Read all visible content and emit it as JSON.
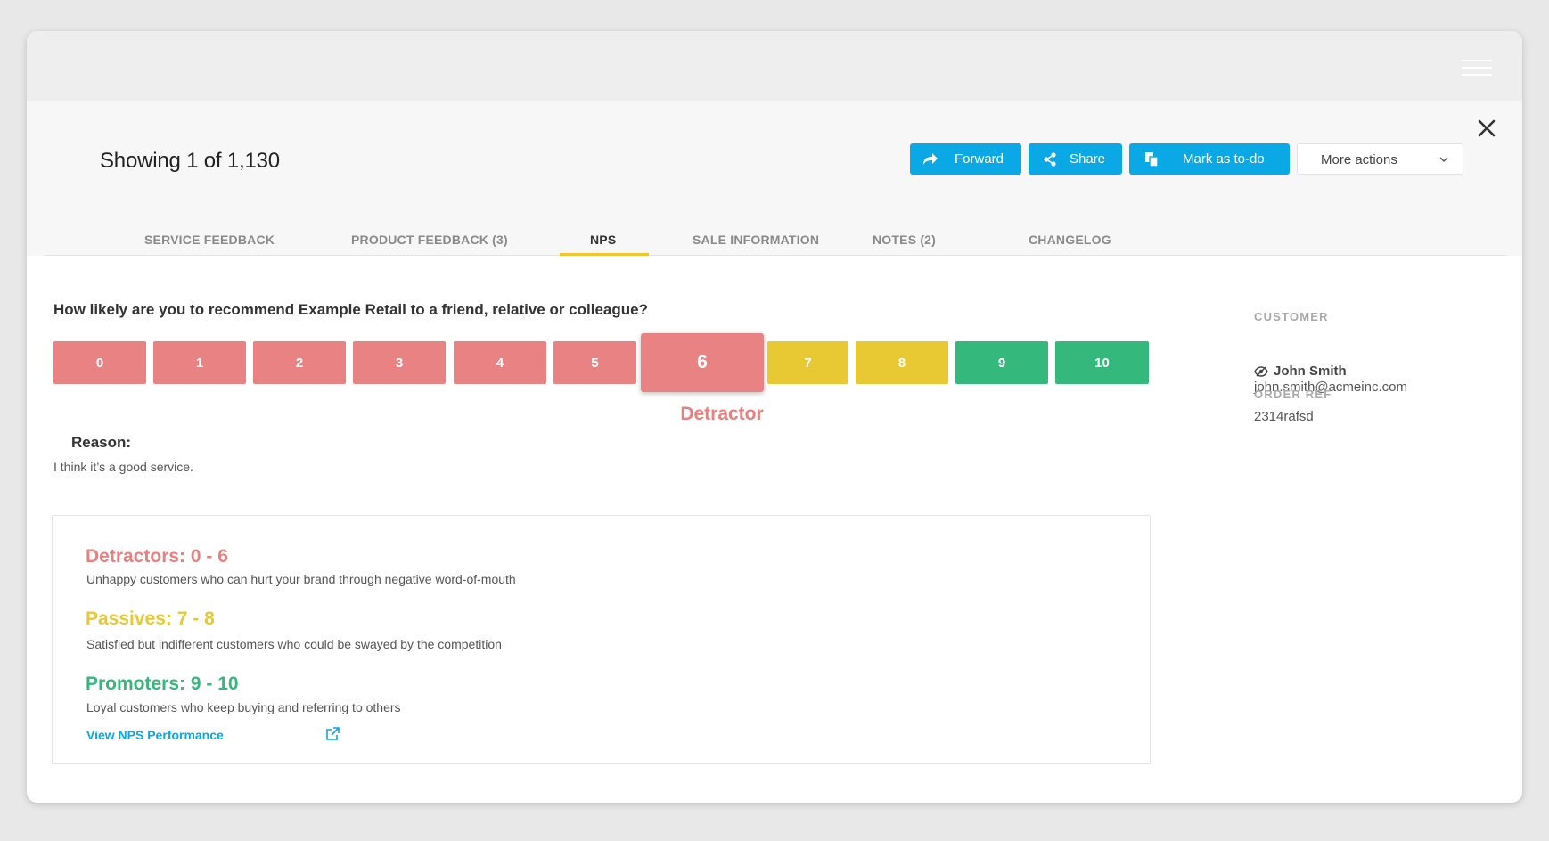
{
  "header": {
    "title": "Showing 1 of 1,130",
    "actions": {
      "forward_label": "Forward",
      "share_label": "Share",
      "todo_label": "Mark as to-do",
      "more_label": "More actions"
    }
  },
  "tabs": [
    {
      "label": "SERVICE FEEDBACK"
    },
    {
      "label": "PRODUCT FEEDBACK (3)"
    },
    {
      "label": "NPS"
    },
    {
      "label": "SALE INFORMATION"
    },
    {
      "label": "NOTES (2)"
    },
    {
      "label": "CHANGELOG"
    }
  ],
  "active_tab": "NPS",
  "nps": {
    "question": "How likely are you to recommend Example Retail to a friend, relative or colleague?",
    "scores": [
      "0",
      "1",
      "2",
      "3",
      "4",
      "5",
      "6",
      "7",
      "8",
      "9",
      "10"
    ],
    "selected_score": 6,
    "verdict": "Detractor",
    "reason_label": "Reason:",
    "reason_text": "I think it’s a good service."
  },
  "legend": {
    "detractors": {
      "title": "Detractors: 0 - 6",
      "desc": "Unhappy customers who can hurt your brand through negative word-of-mouth"
    },
    "passives": {
      "title": "Passives: 7 - 8",
      "desc": "Satisfied but indifferent customers who could be swayed by the competition"
    },
    "promoters": {
      "title": "Promoters: 9 - 10",
      "desc": "Loyal customers who keep buying and referring to others"
    },
    "link_label": "View NPS Performance"
  },
  "sidebar": {
    "customer_label": "CUSTOMER",
    "customer_name": "John Smith",
    "customer_email": "john.smith@acmeinc.com",
    "order_label": "ORDER REF",
    "order_ref": "2314rafsd"
  },
  "colors": {
    "accent": "#0aa9e6",
    "detractor": "#e97f7f",
    "passive": "#e9c933",
    "promoter": "#34b87c",
    "tab_underline": "#f1c62c"
  },
  "icons": [
    "hamburger-icon",
    "close-icon",
    "forward-icon",
    "share-icon",
    "copy-icon",
    "chevron-down-icon",
    "eye-slash-icon",
    "external-link-icon"
  ]
}
